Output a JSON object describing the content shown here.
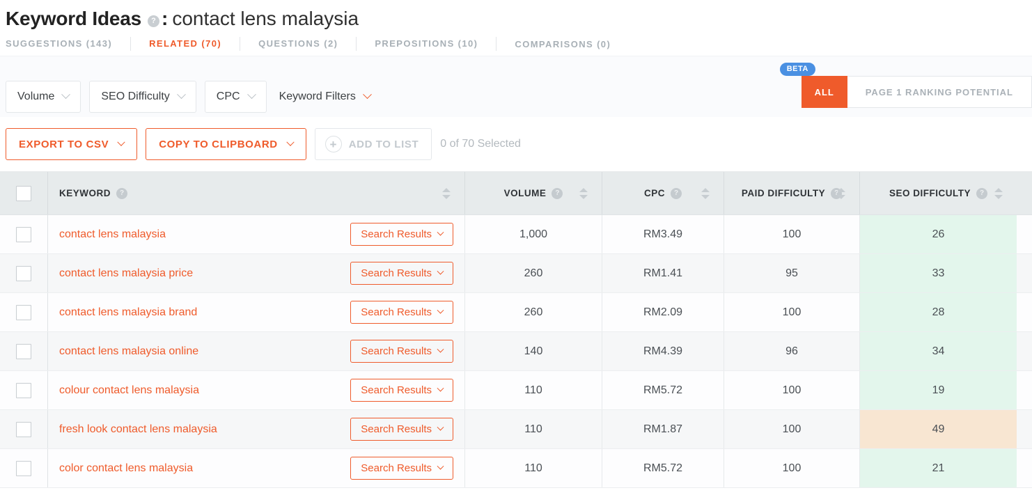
{
  "header": {
    "title": "Keyword Ideas",
    "help_icon": "help-circle-icon",
    "separator": ":",
    "query": "contact lens malaysia"
  },
  "tabs": [
    {
      "label": "SUGGESTIONS (143)",
      "active": false
    },
    {
      "label": "RELATED (70)",
      "active": true
    },
    {
      "label": "QUESTIONS (2)",
      "active": false
    },
    {
      "label": "PREPOSITIONS (10)",
      "active": false
    },
    {
      "label": "COMPARISONS (0)",
      "active": false
    }
  ],
  "filters": {
    "volume": "Volume",
    "seo_difficulty": "SEO Difficulty",
    "cpc": "CPC",
    "keyword_filters": "Keyword Filters"
  },
  "toggle": {
    "beta_badge": "BETA",
    "all": "ALL",
    "page1": "PAGE 1 RANKING POTENTIAL",
    "active_color": "#ef5b2b"
  },
  "actions": {
    "export_csv": "EXPORT TO CSV",
    "copy_clipboard": "COPY TO CLIPBOARD",
    "add_to_list": "ADD TO LIST",
    "selected_count": "0 of 70 Selected"
  },
  "table": {
    "columns": [
      {
        "label": "KEYWORD",
        "help": true
      },
      {
        "label": "VOLUME",
        "help": true
      },
      {
        "label": "CPC",
        "help": true
      },
      {
        "label": "PAID DIFFICULTY",
        "help": true
      },
      {
        "label": "SEO DIFFICULTY",
        "help": true
      }
    ],
    "row_action_label": "Search Results",
    "rows": [
      {
        "keyword": "contact lens malaysia",
        "volume": "1,000",
        "cpc": "RM3.49",
        "paid": "100",
        "seo": "26",
        "seo_level": "green"
      },
      {
        "keyword": "contact lens malaysia price",
        "volume": "260",
        "cpc": "RM1.41",
        "paid": "95",
        "seo": "33",
        "seo_level": "green"
      },
      {
        "keyword": "contact lens malaysia brand",
        "volume": "260",
        "cpc": "RM2.09",
        "paid": "100",
        "seo": "28",
        "seo_level": "green"
      },
      {
        "keyword": "contact lens malaysia online",
        "volume": "140",
        "cpc": "RM4.39",
        "paid": "96",
        "seo": "34",
        "seo_level": "green"
      },
      {
        "keyword": "colour contact lens malaysia",
        "volume": "110",
        "cpc": "RM5.72",
        "paid": "100",
        "seo": "19",
        "seo_level": "green"
      },
      {
        "keyword": "fresh look contact lens malaysia",
        "volume": "110",
        "cpc": "RM1.87",
        "paid": "100",
        "seo": "49",
        "seo_level": "orange"
      },
      {
        "keyword": "color contact lens malaysia",
        "volume": "110",
        "cpc": "RM5.72",
        "paid": "100",
        "seo": "21",
        "seo_level": "green"
      }
    ]
  },
  "colors": {
    "accent": "#ef5b2b",
    "beta_blue": "#4a90e2",
    "seo_green": "#e3f6ec",
    "seo_orange": "#f8e6d2"
  }
}
